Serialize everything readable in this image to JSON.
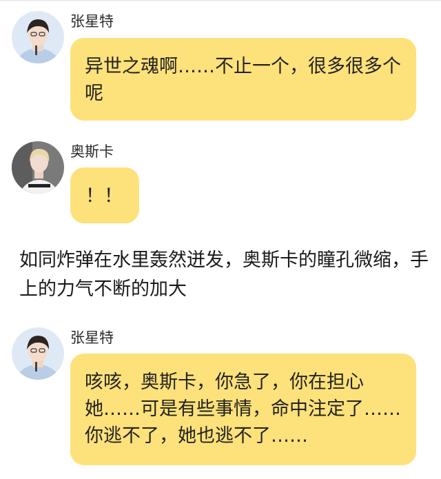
{
  "messages": [
    {
      "sender": "张星特",
      "avatar_icon": "avatar-zhang-xingte",
      "text": "异世之魂啊……不止一个，很多很多个呢"
    },
    {
      "sender": "奥斯卡",
      "avatar_icon": "avatar-aosika",
      "text": "！！"
    },
    {
      "narration": "如同炸弹在水里轰然迸发，奥斯卡的瞳孔微缩，手上的力气不断的加大"
    },
    {
      "sender": "张星特",
      "avatar_icon": "avatar-zhang-xingte",
      "text": "咳咳，奥斯卡，你急了，你在担心她……可是有些事情，命中注定了……你逃不了，她也逃不了……"
    }
  ],
  "colors": {
    "bubble": "#fde17a",
    "background": "#ffffff",
    "text": "#222222"
  }
}
